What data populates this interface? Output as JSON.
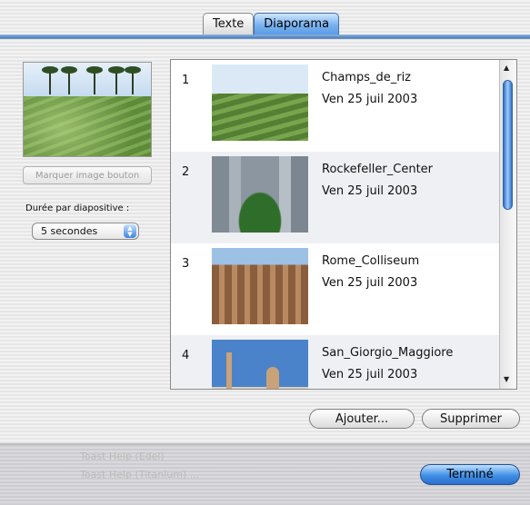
{
  "tabs": [
    {
      "label": "Texte",
      "active": false
    },
    {
      "label": "Diaporama",
      "active": true
    }
  ],
  "left_panel": {
    "mark_button": "Marquer image bouton",
    "duration_label": "Durée par diapositive :",
    "duration_value": "5 secondes"
  },
  "slides": [
    {
      "num": "1",
      "name": "Champs_de_riz",
      "date": "Ven 25 juil 2003"
    },
    {
      "num": "2",
      "name": "Rockefeller_Center",
      "date": "Ven 25 juil 2003"
    },
    {
      "num": "3",
      "name": "Rome_Colliseum",
      "date": "Ven 25 juil 2003"
    },
    {
      "num": "4",
      "name": "San_Giorgio_Maggiore",
      "date": "Ven 25 juil 2003"
    }
  ],
  "buttons": {
    "add": "Ajouter...",
    "remove": "Supprimer",
    "done": "Terminé"
  },
  "background_ghost_items": [
    "Toast Help (Edel)",
    "Toast Help (Titanium) ..."
  ],
  "colors": {
    "accent": "#4a7fc0"
  }
}
